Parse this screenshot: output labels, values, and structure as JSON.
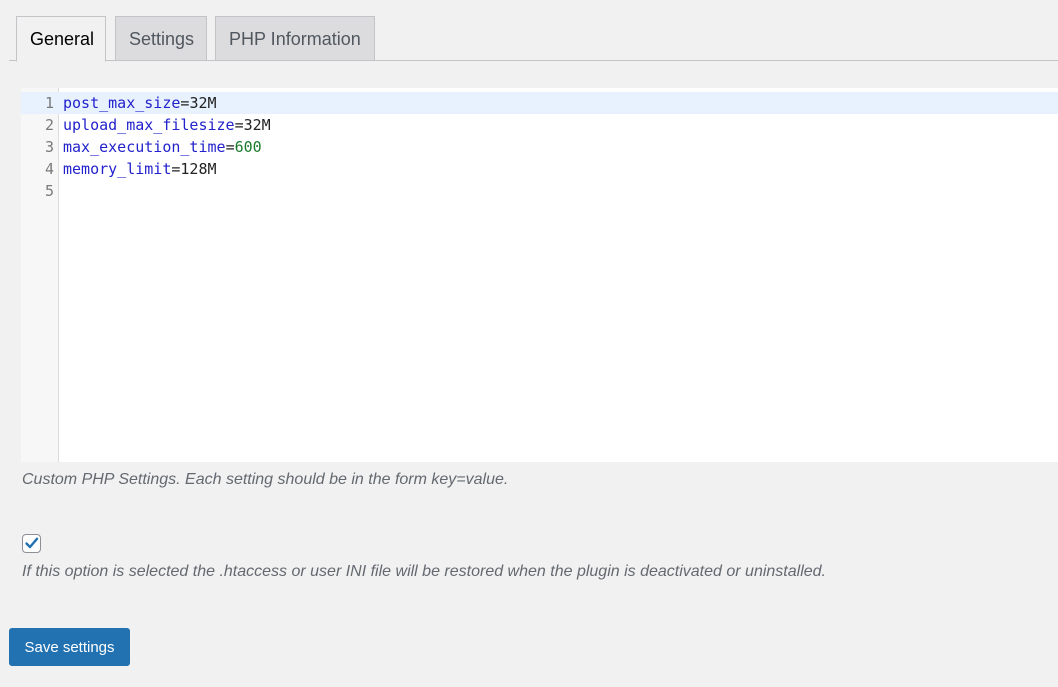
{
  "tabs": [
    {
      "label": "General",
      "active": true
    },
    {
      "label": "Settings",
      "active": false
    },
    {
      "label": "PHP Information",
      "active": false
    }
  ],
  "editor": {
    "lines": [
      {
        "num": "1",
        "key": "post_max_size",
        "op": "=",
        "value": "32M",
        "value_type": "text"
      },
      {
        "num": "2",
        "key": "upload_max_filesize",
        "op": "=",
        "value": "32M",
        "value_type": "text"
      },
      {
        "num": "3",
        "key": "max_execution_time",
        "op": "=",
        "value": "600",
        "value_type": "number"
      },
      {
        "num": "4",
        "key": "memory_limit",
        "op": "=",
        "value": "128M",
        "value_type": "text"
      },
      {
        "num": "5",
        "key": "",
        "op": "",
        "value": "",
        "value_type": "text"
      }
    ],
    "active_line": 1
  },
  "editor_description": "Custom PHP Settings. Each setting should be in the form key=value.",
  "restore_option": {
    "checked": true,
    "description": "If this option is selected the .htaccess or user INI file will be restored when the plugin is deactivated or uninstalled."
  },
  "save_button_label": "Save settings",
  "colors": {
    "button": "#2271b1",
    "checkmark": "#2271b1",
    "key": "#2222cc",
    "number": "#1a7a2a"
  }
}
